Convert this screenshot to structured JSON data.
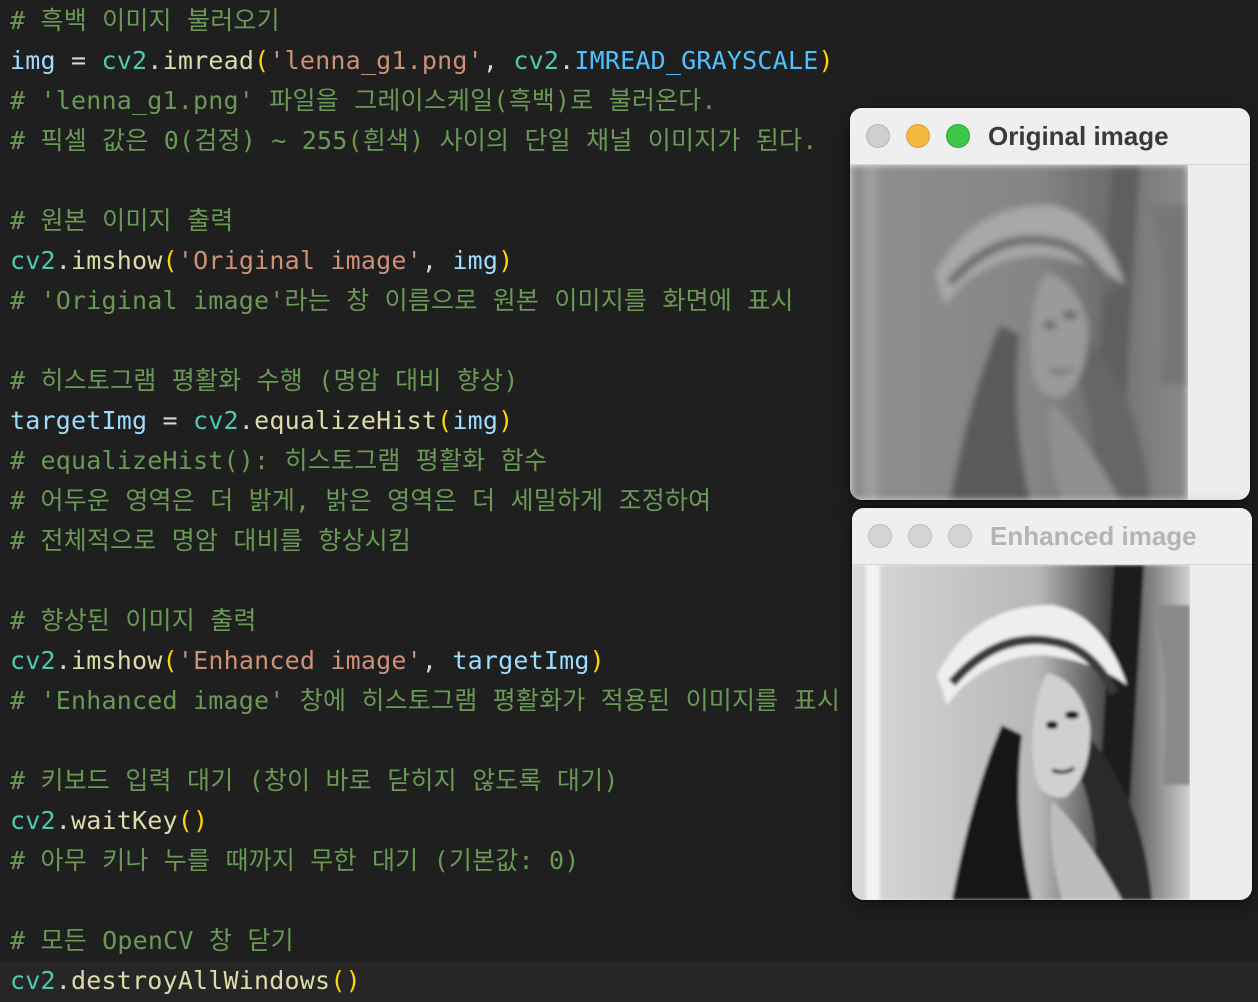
{
  "code_lines": [
    [
      {
        "t": "# 흑백 이미지 불러오기",
        "c": "c"
      }
    ],
    [
      {
        "t": "img",
        "c": "v"
      },
      {
        "t": " = ",
        "c": "p"
      },
      {
        "t": "cv2",
        "c": "m"
      },
      {
        "t": ".",
        "c": "p"
      },
      {
        "t": "imread",
        "c": "f"
      },
      {
        "t": "(",
        "c": "b"
      },
      {
        "t": "'lenna_g1.png'",
        "c": "s"
      },
      {
        "t": ", ",
        "c": "p"
      },
      {
        "t": "cv2",
        "c": "m"
      },
      {
        "t": ".",
        "c": "p"
      },
      {
        "t": "IMREAD_GRAYSCALE",
        "c": "k"
      },
      {
        "t": ")",
        "c": "b"
      }
    ],
    [
      {
        "t": "# 'lenna_g1.png' 파일을 그레이스케일(흑백)로 불러온다.",
        "c": "c"
      }
    ],
    [
      {
        "t": "# 픽셀 값은 0(검정) ~ 255(흰색) 사이의 단일 채널 이미지가 된다.",
        "c": "c"
      }
    ],
    [],
    [
      {
        "t": "# 원본 이미지 출력",
        "c": "c"
      }
    ],
    [
      {
        "t": "cv2",
        "c": "m"
      },
      {
        "t": ".",
        "c": "p"
      },
      {
        "t": "imshow",
        "c": "f"
      },
      {
        "t": "(",
        "c": "b"
      },
      {
        "t": "'Original image'",
        "c": "s"
      },
      {
        "t": ", ",
        "c": "p"
      },
      {
        "t": "img",
        "c": "v"
      },
      {
        "t": ")",
        "c": "b"
      }
    ],
    [
      {
        "t": "# 'Original image'라는 창 이름으로 원본 이미지를 화면에 표시",
        "c": "c"
      }
    ],
    [],
    [
      {
        "t": "# 히스토그램 평활화 수행 (명암 대비 향상)",
        "c": "c"
      }
    ],
    [
      {
        "t": "targetImg",
        "c": "v"
      },
      {
        "t": " = ",
        "c": "p"
      },
      {
        "t": "cv2",
        "c": "m"
      },
      {
        "t": ".",
        "c": "p"
      },
      {
        "t": "equalizeHist",
        "c": "f"
      },
      {
        "t": "(",
        "c": "b"
      },
      {
        "t": "img",
        "c": "v"
      },
      {
        "t": ")",
        "c": "b"
      }
    ],
    [
      {
        "t": "# equalizeHist(): 히스토그램 평활화 함수",
        "c": "c"
      }
    ],
    [
      {
        "t": "# 어두운 영역은 더 밝게, 밝은 영역은 더 세밀하게 조정하여",
        "c": "c"
      }
    ],
    [
      {
        "t": "# 전체적으로 명암 대비를 향상시킴",
        "c": "c"
      }
    ],
    [],
    [
      {
        "t": "# 향상된 이미지 출력",
        "c": "c"
      }
    ],
    [
      {
        "t": "cv2",
        "c": "m"
      },
      {
        "t": ".",
        "c": "p"
      },
      {
        "t": "imshow",
        "c": "f"
      },
      {
        "t": "(",
        "c": "b"
      },
      {
        "t": "'Enhanced image'",
        "c": "s"
      },
      {
        "t": ", ",
        "c": "p"
      },
      {
        "t": "targetImg",
        "c": "v"
      },
      {
        "t": ")",
        "c": "b"
      }
    ],
    [
      {
        "t": "# 'Enhanced image' 창에 히스토그램 평활화가 적용된 이미지를 표시",
        "c": "c"
      }
    ],
    [],
    [
      {
        "t": "# 키보드 입력 대기 (창이 바로 닫히지 않도록 대기)",
        "c": "c"
      }
    ],
    [
      {
        "t": "cv2",
        "c": "m"
      },
      {
        "t": ".",
        "c": "p"
      },
      {
        "t": "waitKey",
        "c": "f"
      },
      {
        "t": "()",
        "c": "b"
      }
    ],
    [
      {
        "t": "# 아무 키나 누를 때까지 무한 대기 (기본값: 0)",
        "c": "c"
      }
    ],
    [],
    [
      {
        "t": "# 모든 OpenCV 창 닫기",
        "c": "c"
      }
    ],
    [
      {
        "t": "cv2",
        "c": "m"
      },
      {
        "t": ".",
        "c": "p"
      },
      {
        "t": "destroyAllWindows",
        "c": "f"
      },
      {
        "t": "()",
        "c": "b"
      }
    ]
  ],
  "current_line": 24,
  "windows": {
    "original": {
      "title": "Original image",
      "state": "active",
      "image": "grayscale portrait (low contrast)"
    },
    "enhanced": {
      "title": "Enhanced image",
      "state": "inactive",
      "image": "grayscale portrait (equalized, high contrast)"
    }
  },
  "colors": {
    "editor_bg": "#1f1f1f",
    "comment": "#6a9955",
    "variable": "#9cdcfe",
    "module": "#4ec9b0",
    "function": "#dcdcaa",
    "string": "#ce9178",
    "constant": "#4fc1ff",
    "bracket": "#ffd700"
  }
}
